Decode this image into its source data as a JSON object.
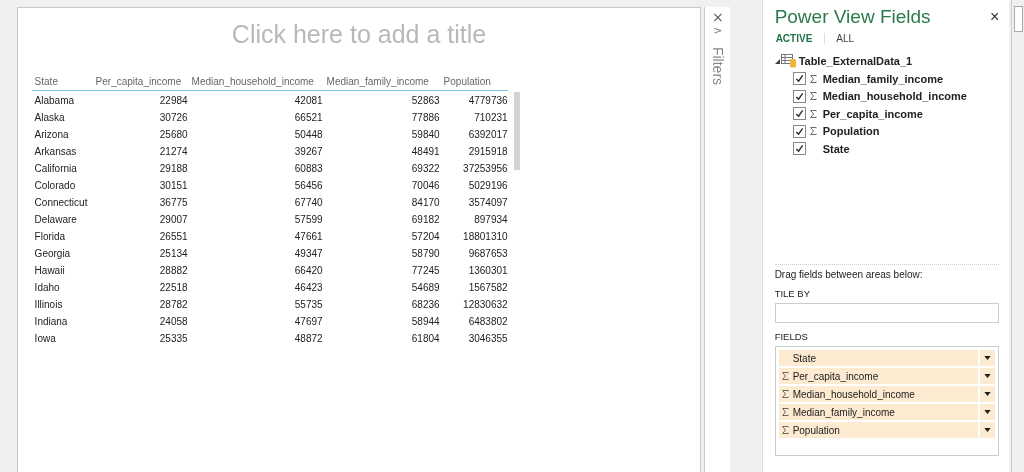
{
  "canvas": {
    "title_placeholder": "Click here to add a title"
  },
  "table": {
    "columns": [
      "State",
      "Per_capita_income",
      "Median_household_income",
      "Median_family_income",
      "Population"
    ],
    "rows": [
      [
        "Alabama",
        "22984",
        "42081",
        "52863",
        "4779736"
      ],
      [
        "Alaska",
        "30726",
        "66521",
        "77886",
        "710231"
      ],
      [
        "Arizona",
        "25680",
        "50448",
        "59840",
        "6392017"
      ],
      [
        "Arkansas",
        "21274",
        "39267",
        "48491",
        "2915918"
      ],
      [
        "California",
        "29188",
        "60883",
        "69322",
        "37253956"
      ],
      [
        "Colorado",
        "30151",
        "56456",
        "70046",
        "5029196"
      ],
      [
        "Connecticut",
        "36775",
        "67740",
        "84170",
        "3574097"
      ],
      [
        "Delaware",
        "29007",
        "57599",
        "69182",
        "897934"
      ],
      [
        "Florida",
        "26551",
        "47661",
        "57204",
        "18801310"
      ],
      [
        "Georgia",
        "25134",
        "49347",
        "58790",
        "9687653"
      ],
      [
        "Hawaii",
        "28882",
        "66420",
        "77245",
        "1360301"
      ],
      [
        "Idaho",
        "22518",
        "46423",
        "54689",
        "1567582"
      ],
      [
        "Illinois",
        "28782",
        "55735",
        "68236",
        "12830632"
      ],
      [
        "Indiana",
        "24058",
        "47697",
        "58944",
        "6483802"
      ],
      [
        "Iowa",
        "25335",
        "48872",
        "61804",
        "3046355"
      ]
    ]
  },
  "filters_pane": {
    "close": "×",
    "expand": ">",
    "label": "Filters"
  },
  "fields_panel": {
    "title": "Power View Fields",
    "close": "×",
    "tabs": [
      {
        "label": "ACTIVE",
        "selected": true
      },
      {
        "label": "ALL",
        "selected": false
      }
    ],
    "table_name": "Table_ExternalData_1",
    "fields": [
      {
        "name": "Median_family_income",
        "checked": true,
        "sigma": true
      },
      {
        "name": "Median_household_income",
        "checked": true,
        "sigma": true
      },
      {
        "name": "Per_capita_income",
        "checked": true,
        "sigma": true
      },
      {
        "name": "Population",
        "checked": true,
        "sigma": true
      },
      {
        "name": "State",
        "checked": true,
        "sigma": false
      }
    ],
    "hint": "Drag fields between areas below:",
    "tile_by_label": "TILE BY",
    "fields_label": "FIELDS",
    "field_wells": [
      {
        "name": "State",
        "sigma": false
      },
      {
        "name": "Per_capita_income",
        "sigma": true
      },
      {
        "name": "Median_household_income",
        "sigma": true
      },
      {
        "name": "Median_family_income",
        "sigma": true
      },
      {
        "name": "Population",
        "sigma": true
      }
    ]
  }
}
